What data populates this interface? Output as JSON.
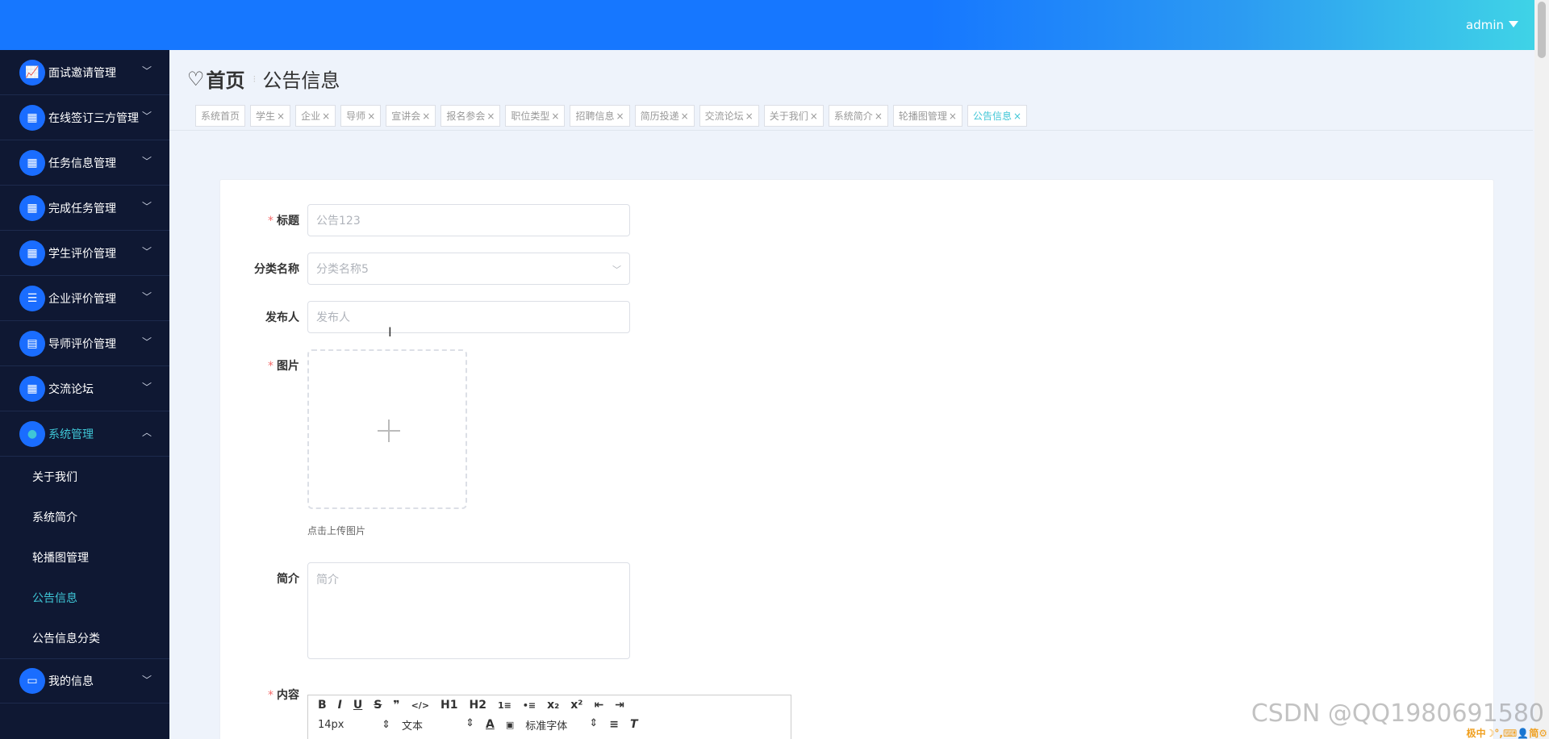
{
  "header": {
    "username": "admin"
  },
  "sidebar": {
    "items": [
      {
        "label": "面试邀请管理",
        "icon": "chart-icon"
      },
      {
        "label": "在线签订三方管理",
        "icon": "grid-icon"
      },
      {
        "label": "任务信息管理",
        "icon": "grid-icon"
      },
      {
        "label": "完成任务管理",
        "icon": "grid-icon"
      },
      {
        "label": "学生评价管理",
        "icon": "grid-icon"
      },
      {
        "label": "企业评价管理",
        "icon": "list-icon"
      },
      {
        "label": "导师评价管理",
        "icon": "clipboard-icon"
      },
      {
        "label": "交流论坛",
        "icon": "grid-icon"
      },
      {
        "label": "系统管理",
        "icon": "bulb-icon"
      }
    ],
    "subitems": [
      "关于我们",
      "系统简介",
      "轮播图管理",
      "公告信息",
      "公告信息分类"
    ],
    "last_item": {
      "label": "我的信息",
      "icon": "card-icon"
    }
  },
  "breadcrumb": {
    "home": "首页",
    "current": "公告信息"
  },
  "tabs": [
    "系统首页",
    "学生",
    "企业",
    "导师",
    "宣讲会",
    "报名参会",
    "职位类型",
    "招聘信息",
    "简历投递",
    "交流论坛",
    "关于我们",
    "系统简介",
    "轮播图管理",
    "公告信息"
  ],
  "form": {
    "title_label": "标题",
    "title_value": "公告123",
    "category_label": "分类名称",
    "category_value": "分类名称5",
    "publisher_label": "发布人",
    "publisher_placeholder": "发布人",
    "image_label": "图片",
    "upload_hint": "点击上传图片",
    "intro_label": "简介",
    "intro_placeholder": "简介",
    "content_label": "内容"
  },
  "editor": {
    "toolbar1": [
      "B",
      "I",
      "U",
      "S",
      "❞",
      "</>",
      "H1",
      "H2",
      "1≡",
      "•≡",
      "x₂",
      "x²",
      "⇤",
      "⇥"
    ],
    "font_size": "14px",
    "text_style": "文本",
    "font_family": "标准字体"
  },
  "watermark": "CSDN @QQ1980691580",
  "tray_text": "极中☽°,⌨👤简⚙",
  "colors": {
    "header_blue": "#1677ff",
    "sidebar_bg": "#0f1833",
    "accent_cyan": "#3fc6d6",
    "required_red": "#f56c6c"
  }
}
